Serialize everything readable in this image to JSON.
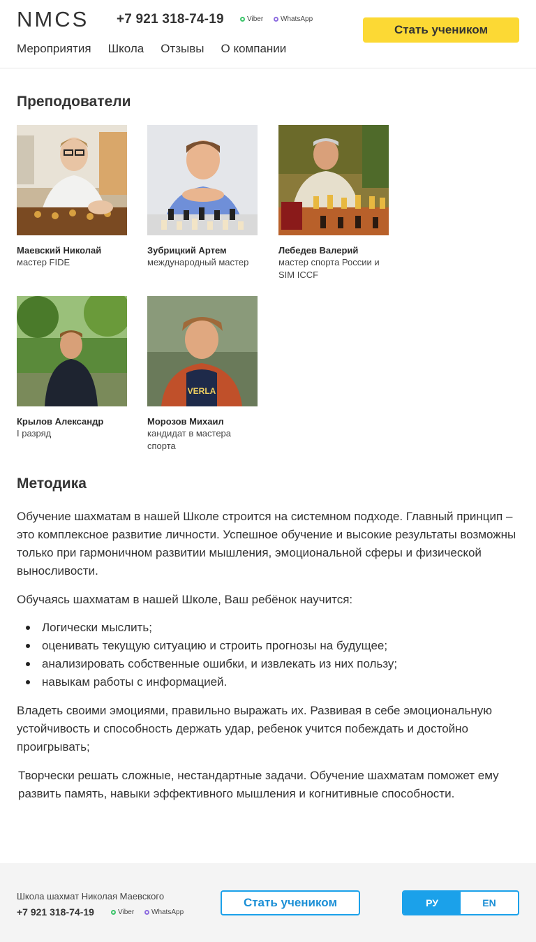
{
  "header": {
    "logo": "NMCS",
    "phone": "+7 921 318-74-19",
    "viber": "Viber",
    "whatsapp": "WhatsApp",
    "cta": "Стать учеником",
    "nav": [
      "Мероприятия",
      "Школа",
      "Отзывы",
      "О компании"
    ]
  },
  "teachers": {
    "title": "Преподователи",
    "items": [
      {
        "name": "Маевский Николай",
        "rank": "мастер FIDE"
      },
      {
        "name": "Зубрицкий Артем",
        "rank": "международный мастер"
      },
      {
        "name": "Лебедев Валерий",
        "rank": "мастер спорта России и SIM ICCF"
      },
      {
        "name": "Крылов Александр",
        "rank": "I разряд"
      },
      {
        "name": "Морозов Михаил",
        "rank": "кандидат в мастера спорта"
      }
    ]
  },
  "method": {
    "title": "Методика",
    "p1": "Обучение шахматам в нашей Школе строится на системном подходе. Главный принцип – это комплексное развитие личности. Успешное обучение и высокие результаты возможны только при гармоничном развитии мышления, эмоциональной сферы и физической выносливости.",
    "p2": "Обучаясь шахматам в нашей Школе, Ваш ребёнок научится:",
    "bullets": [
      "Логически мыслить;",
      "оценивать текущую ситуацию и строить прогнозы на будущее;",
      "анализировать собственные ошибки, и извлекать из них пользу;",
      "навыкам работы с информацией."
    ],
    "p3": "Владеть своими эмоциями, правильно выражать их. Развивая в себе эмоциональную устойчивость и способность держать удар, ребенок учится побеждать и достойно проигрывать;",
    "p4": "Творчески решать сложные, нестандартные задачи. Обучение шахматам поможет ему развить память,  навыки эффективного мышления и когнитивные способности."
  },
  "footer": {
    "school": "Школа шахмат Николая Маевского",
    "phone": "+7 921 318-74-19",
    "viber": "Viber",
    "whatsapp": "WhatsApp",
    "cta": "Стать учеником",
    "lang": [
      "РУ",
      "EN"
    ],
    "active_lang": "РУ"
  },
  "colors": {
    "accent_yellow": "#fcd934",
    "accent_blue": "#1ba1ea"
  }
}
